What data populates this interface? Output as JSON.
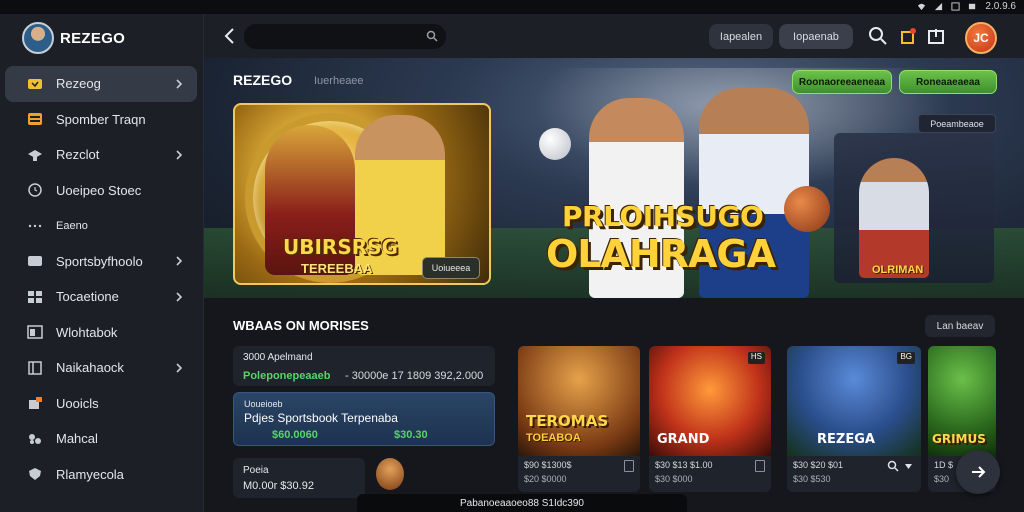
{
  "status_bar": {
    "version": "2.0.9.6"
  },
  "sidebar": {
    "brand": "REZEGO",
    "items": [
      {
        "label": "Rezeog",
        "icon": "ticket-icon",
        "active": true,
        "chevron": true
      },
      {
        "label": "Spomber Traqn",
        "icon": "calendar-icon",
        "active": false,
        "chevron": false
      },
      {
        "label": "Rezclot",
        "icon": "cap-icon",
        "active": false,
        "chevron": true
      },
      {
        "label": "Uoeipeo Stoec",
        "icon": "clock-icon",
        "active": false,
        "chevron": false
      },
      {
        "label": "Eaeno",
        "icon": "dots-icon",
        "active": false,
        "chevron": false
      },
      {
        "label": "Sportsbyfhoolo",
        "icon": "card-icon",
        "active": false,
        "chevron": true
      },
      {
        "label": "Tocaetione",
        "icon": "grid-icon",
        "active": false,
        "chevron": true
      },
      {
        "label": "Wlohtabok",
        "icon": "screen-icon",
        "active": false,
        "chevron": false
      },
      {
        "label": "Naikahaock",
        "icon": "book-icon",
        "active": false,
        "chevron": true
      },
      {
        "label": "Uooicls",
        "icon": "gift-icon",
        "active": false,
        "chevron": false
      },
      {
        "label": "Mahcal",
        "icon": "puzzle-icon",
        "active": false,
        "chevron": false
      },
      {
        "label": "Rlamyecola",
        "icon": "shield-icon",
        "active": false,
        "chevron": false
      }
    ]
  },
  "topbar": {
    "search_placeholder": "",
    "login_label": "Iapealen",
    "register_label": "Iopaenab",
    "profile_initials": "JC"
  },
  "hero": {
    "brand": "REZEGO",
    "brand_sub": "Iuerheaee",
    "btn1": "Roonaoreeaeneaa",
    "btn2": "Roneaaeaeaa",
    "promo_title": "UBIRSRSG",
    "promo_sub": "TEREEBAA",
    "promo_btn": "Uoiueeea",
    "headline_1": "PRLOIHSUGO",
    "headline_2": "OLAHRAGA",
    "side_badge": "Poeambeaoe",
    "side_title": "OLRIMAN"
  },
  "lower": {
    "section_title": "WBAAS ON MORISES",
    "see_all": "Lan baeav",
    "bets": [
      {
        "line1": "3000 Apelmand",
        "odds_left": "Poleponepeaaeb",
        "odds_right": "- 30000e 17 1809 392,2.000"
      },
      {
        "line0": "Uoueioeb",
        "line1": "Pdjes Sportsbook Terpenaba",
        "odds_left": "$60.0060",
        "odds_right": "$30.30"
      },
      {
        "line1": "Poeia",
        "odds_left": "M0.00r $30.92"
      }
    ],
    "games": [
      {
        "title": "TEROMAS",
        "sub": "TOEABOA",
        "meta1": "$90 $1300$",
        "meta2": "$20 $0000"
      },
      {
        "title": "GRAND",
        "sub": "",
        "meta1": "$30 $13 $1.00",
        "meta2": "$30 $000",
        "badge": "HS"
      },
      {
        "title": "REZEGA",
        "sub": "",
        "meta1": "$30 $20 $01",
        "meta2": "$30 $530",
        "badge": "BG"
      },
      {
        "title": "GRIMUS",
        "sub": "",
        "meta1": "1D $",
        "meta2": "$30"
      }
    ]
  },
  "bottom_bar": "Pabanoeaaoeo88 S1Idc390"
}
